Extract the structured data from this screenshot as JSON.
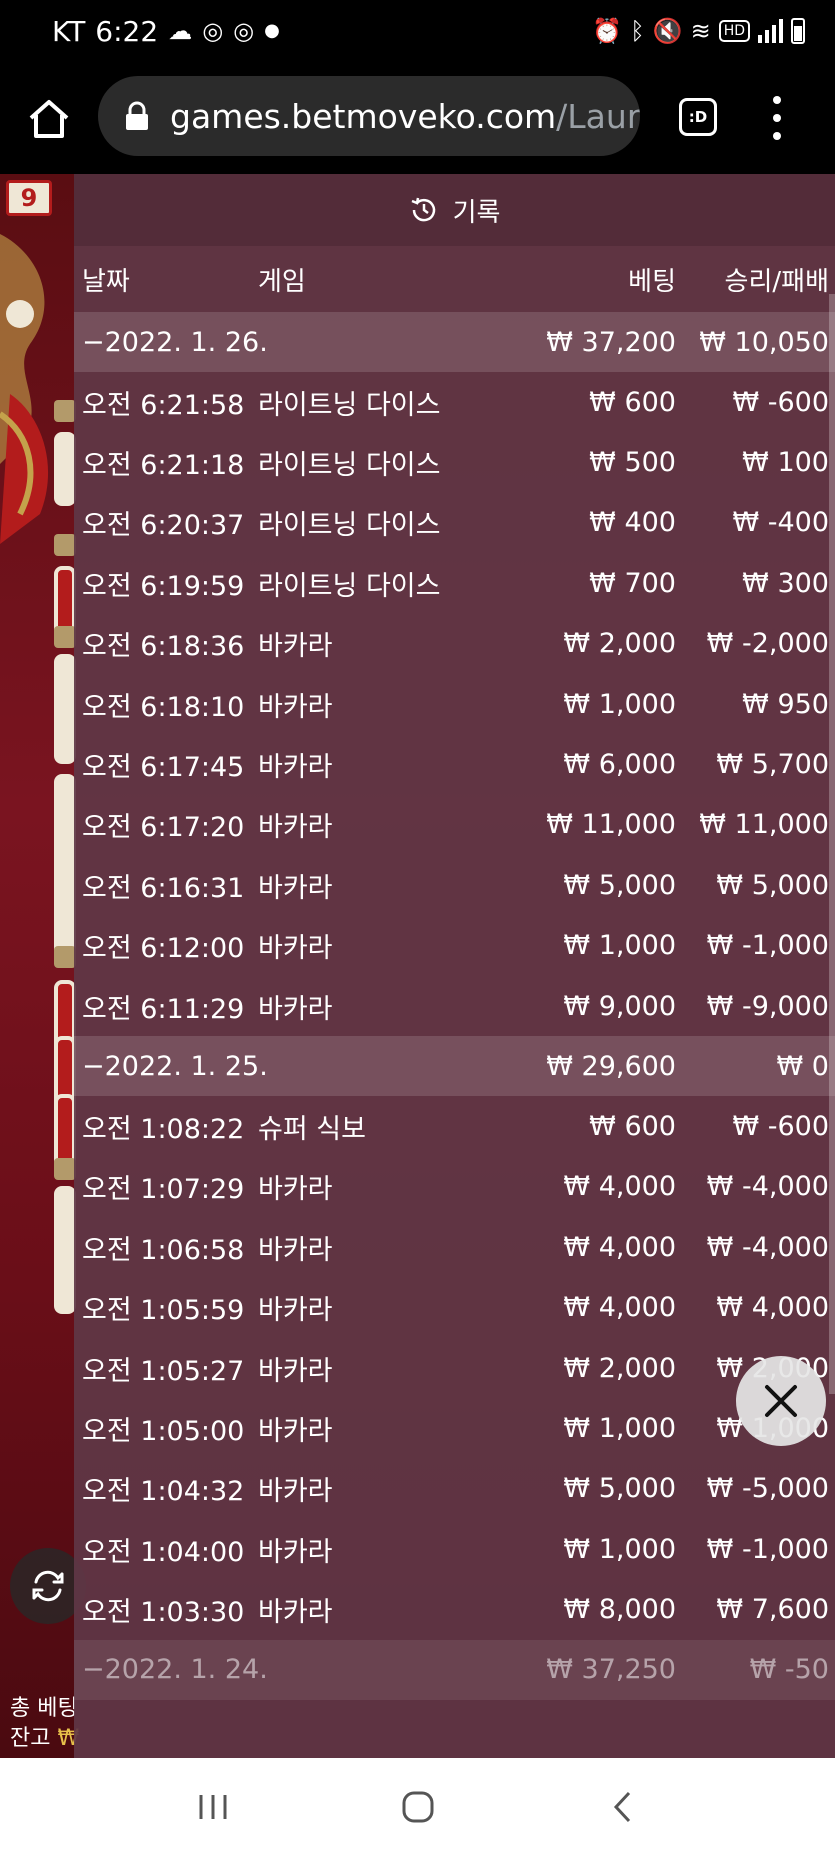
{
  "status_bar": {
    "carrier": "KT",
    "time": "6:22",
    "hd_label": "HD"
  },
  "browser": {
    "url_host": "games.betmoveko.com",
    "url_path": "/Laur",
    "tab_label": ":D"
  },
  "game": {
    "round_badge": "9",
    "total_bet_label": "총 베팅",
    "balance_label": "잔고"
  },
  "history": {
    "title": "기록",
    "columns": {
      "date": "날짜",
      "game": "게임",
      "bet": "베팅",
      "result": "승리/패배"
    },
    "groups": [
      {
        "date": "−2022. 1. 26.",
        "bet": "₩ 37,200",
        "result": "₩ 10,050",
        "rows": [
          {
            "time": "오전 6:21:58",
            "game": "라이트닝 다이스",
            "bet": "₩ 600",
            "result": "₩ -600"
          },
          {
            "time": "오전 6:21:18",
            "game": "라이트닝 다이스",
            "bet": "₩ 500",
            "result": "₩ 100"
          },
          {
            "time": "오전 6:20:37",
            "game": "라이트닝 다이스",
            "bet": "₩ 400",
            "result": "₩ -400"
          },
          {
            "time": "오전 6:19:59",
            "game": "라이트닝 다이스",
            "bet": "₩ 700",
            "result": "₩ 300"
          },
          {
            "time": "오전 6:18:36",
            "game": "바카라",
            "bet": "₩ 2,000",
            "result": "₩ -2,000"
          },
          {
            "time": "오전 6:18:10",
            "game": "바카라",
            "bet": "₩ 1,000",
            "result": "₩ 950"
          },
          {
            "time": "오전 6:17:45",
            "game": "바카라",
            "bet": "₩ 6,000",
            "result": "₩ 5,700"
          },
          {
            "time": "오전 6:17:20",
            "game": "바카라",
            "bet": "₩ 11,000",
            "result": "₩ 11,000"
          },
          {
            "time": "오전 6:16:31",
            "game": "바카라",
            "bet": "₩ 5,000",
            "result": "₩ 5,000"
          },
          {
            "time": "오전 6:12:00",
            "game": "바카라",
            "bet": "₩ 1,000",
            "result": "₩ -1,000"
          },
          {
            "time": "오전 6:11:29",
            "game": "바카라",
            "bet": "₩ 9,000",
            "result": "₩ -9,000"
          }
        ]
      },
      {
        "date": "−2022. 1. 25.",
        "bet": "₩ 29,600",
        "result": "₩ 0",
        "rows": [
          {
            "time": "오전 1:08:22",
            "game": "슈퍼 식보",
            "bet": "₩ 600",
            "result": "₩ -600"
          },
          {
            "time": "오전 1:07:29",
            "game": "바카라",
            "bet": "₩ 4,000",
            "result": "₩ -4,000"
          },
          {
            "time": "오전 1:06:58",
            "game": "바카라",
            "bet": "₩ 4,000",
            "result": "₩ -4,000"
          },
          {
            "time": "오전 1:05:59",
            "game": "바카라",
            "bet": "₩ 4,000",
            "result": "₩ 4,000"
          },
          {
            "time": "오전 1:05:27",
            "game": "바카라",
            "bet": "₩ 2,000",
            "result": "₩ 2,000"
          },
          {
            "time": "오전 1:05:00",
            "game": "바카라",
            "bet": "₩ 1,000",
            "result": "₩ 1,000"
          },
          {
            "time": "오전 1:04:32",
            "game": "바카라",
            "bet": "₩ 5,000",
            "result": "₩ -5,000"
          },
          {
            "time": "오전 1:04:00",
            "game": "바카라",
            "bet": "₩ 1,000",
            "result": "₩ -1,000"
          },
          {
            "time": "오전 1:03:30",
            "game": "바카라",
            "bet": "₩ 8,000",
            "result": "₩ 7,600"
          }
        ]
      },
      {
        "date": "−2022. 1. 24.",
        "bet": "₩ 37,250",
        "result": "₩ -50",
        "rows": []
      }
    ]
  },
  "colors": {
    "overlay": "#5f3746",
    "game_bg": "#7a1420",
    "accent_gold": "#e7c04a"
  },
  "icons": [
    "home-icon",
    "lock-icon",
    "tabs-icon",
    "more-menu-icon",
    "history-clock-icon",
    "close-icon",
    "swap-icon",
    "recents-icon",
    "home-nav-icon",
    "back-icon"
  ]
}
